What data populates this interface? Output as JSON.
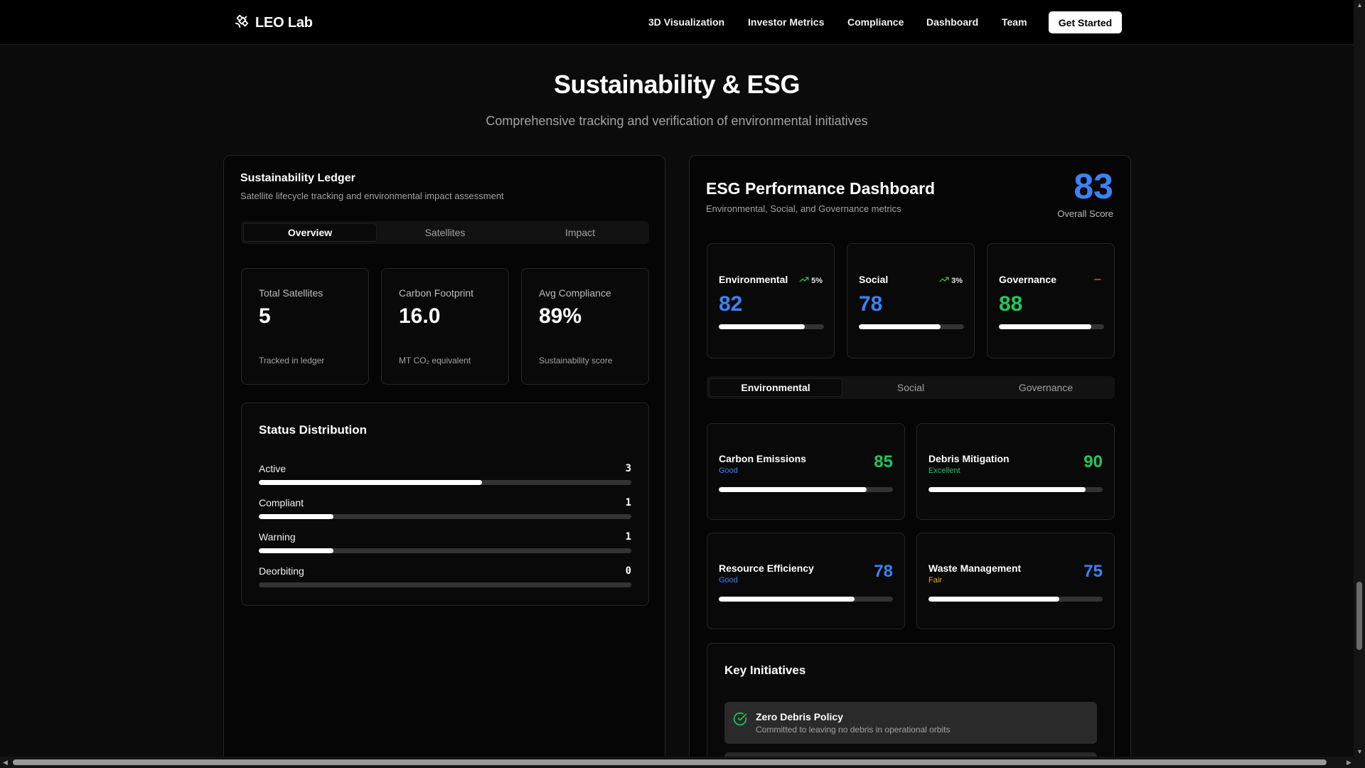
{
  "nav": {
    "brand": "LEO Lab",
    "links": [
      "3D Visualization",
      "Investor Metrics",
      "Compliance",
      "Dashboard",
      "Team"
    ],
    "cta": "Get Started"
  },
  "hero": {
    "title": "Sustainability & ESG",
    "subtitle": "Comprehensive tracking and verification of environmental initiatives"
  },
  "ledger": {
    "title": "Sustainability Ledger",
    "subtitle": "Satellite lifecycle tracking and environmental impact assessment",
    "tabs": [
      "Overview",
      "Satellites",
      "Impact"
    ],
    "stats": [
      {
        "label": "Total Satellites",
        "value": "5",
        "foot": "Tracked in ledger"
      },
      {
        "label": "Carbon Footprint",
        "value": "16.0",
        "foot": "MT CO₂ equivalent"
      },
      {
        "label": "Avg Compliance",
        "value": "89%",
        "foot": "Sustainability score"
      }
    ],
    "distribution": {
      "title": "Status Distribution",
      "items": [
        {
          "label": "Active",
          "count": "3",
          "fraction": 0.6
        },
        {
          "label": "Compliant",
          "count": "1",
          "fraction": 0.2
        },
        {
          "label": "Warning",
          "count": "1",
          "fraction": 0.2
        },
        {
          "label": "Deorbiting",
          "count": "0",
          "fraction": 0
        }
      ]
    }
  },
  "esg": {
    "title": "ESG Performance Dashboard",
    "subtitle": "Environmental, Social, and Governance metrics",
    "overall_score": "83",
    "overall_label": "Overall Score",
    "pillars": [
      {
        "name": "Environmental",
        "trend": "5%",
        "trend_icon": "trending-up-icon",
        "value": "82",
        "fraction": 0.82,
        "color": "#3b82f6"
      },
      {
        "name": "Social",
        "trend": "3%",
        "trend_icon": "trending-up-icon",
        "value": "78",
        "fraction": 0.78,
        "color": "#3b82f6"
      },
      {
        "name": "Governance",
        "trend": "",
        "trend_icon": "minus-icon",
        "value": "88",
        "fraction": 0.88,
        "color": "#22c55e"
      }
    ],
    "tabs": [
      "Environmental",
      "Social",
      "Governance"
    ],
    "metrics": [
      {
        "name": "Carbon Emissions",
        "status": "Good",
        "status_color": "#3b82f6",
        "value": "85",
        "value_color": "#22c55e",
        "fraction": 0.85
      },
      {
        "name": "Debris Mitigation",
        "status": "Excellent",
        "status_color": "#22c55e",
        "value": "90",
        "value_color": "#22c55e",
        "fraction": 0.9
      },
      {
        "name": "Resource Efficiency",
        "status": "Good",
        "status_color": "#3b82f6",
        "value": "78",
        "value_color": "#3b82f6",
        "fraction": 0.78
      },
      {
        "name": "Waste Management",
        "status": "Fair",
        "status_color": "#eab308",
        "value": "75",
        "value_color": "#3b82f6",
        "fraction": 0.75
      }
    ],
    "initiatives": {
      "title": "Key Initiatives",
      "items": [
        {
          "title": "Zero Debris Policy",
          "desc": "Committed to leaving no debris in operational orbits",
          "icon": "check-circle-icon"
        }
      ]
    }
  },
  "colors": {
    "accent_blue": "#3b82f6",
    "accent_green": "#22c55e",
    "accent_orange": "#f97316",
    "warning_yellow": "#eab308"
  }
}
